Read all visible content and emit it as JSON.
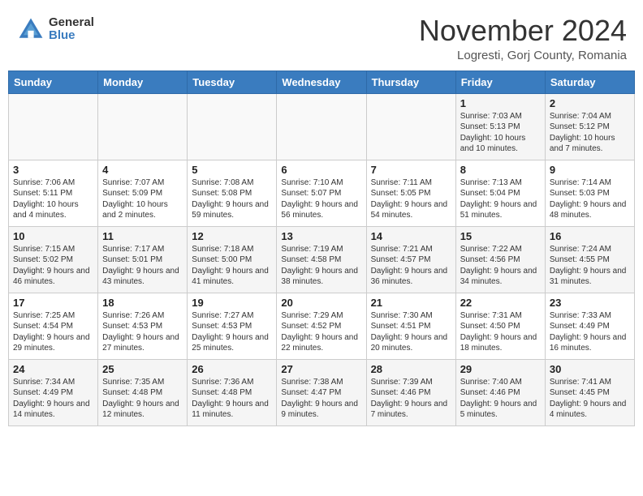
{
  "header": {
    "logo_general": "General",
    "logo_blue": "Blue",
    "month_title": "November 2024",
    "location": "Logresti, Gorj County, Romania"
  },
  "days_of_week": [
    "Sunday",
    "Monday",
    "Tuesday",
    "Wednesday",
    "Thursday",
    "Friday",
    "Saturday"
  ],
  "weeks": [
    [
      {
        "day": "",
        "info": ""
      },
      {
        "day": "",
        "info": ""
      },
      {
        "day": "",
        "info": ""
      },
      {
        "day": "",
        "info": ""
      },
      {
        "day": "",
        "info": ""
      },
      {
        "day": "1",
        "info": "Sunrise: 7:03 AM\nSunset: 5:13 PM\nDaylight: 10 hours and 10 minutes."
      },
      {
        "day": "2",
        "info": "Sunrise: 7:04 AM\nSunset: 5:12 PM\nDaylight: 10 hours and 7 minutes."
      }
    ],
    [
      {
        "day": "3",
        "info": "Sunrise: 7:06 AM\nSunset: 5:11 PM\nDaylight: 10 hours and 4 minutes."
      },
      {
        "day": "4",
        "info": "Sunrise: 7:07 AM\nSunset: 5:09 PM\nDaylight: 10 hours and 2 minutes."
      },
      {
        "day": "5",
        "info": "Sunrise: 7:08 AM\nSunset: 5:08 PM\nDaylight: 9 hours and 59 minutes."
      },
      {
        "day": "6",
        "info": "Sunrise: 7:10 AM\nSunset: 5:07 PM\nDaylight: 9 hours and 56 minutes."
      },
      {
        "day": "7",
        "info": "Sunrise: 7:11 AM\nSunset: 5:05 PM\nDaylight: 9 hours and 54 minutes."
      },
      {
        "day": "8",
        "info": "Sunrise: 7:13 AM\nSunset: 5:04 PM\nDaylight: 9 hours and 51 minutes."
      },
      {
        "day": "9",
        "info": "Sunrise: 7:14 AM\nSunset: 5:03 PM\nDaylight: 9 hours and 48 minutes."
      }
    ],
    [
      {
        "day": "10",
        "info": "Sunrise: 7:15 AM\nSunset: 5:02 PM\nDaylight: 9 hours and 46 minutes."
      },
      {
        "day": "11",
        "info": "Sunrise: 7:17 AM\nSunset: 5:01 PM\nDaylight: 9 hours and 43 minutes."
      },
      {
        "day": "12",
        "info": "Sunrise: 7:18 AM\nSunset: 5:00 PM\nDaylight: 9 hours and 41 minutes."
      },
      {
        "day": "13",
        "info": "Sunrise: 7:19 AM\nSunset: 4:58 PM\nDaylight: 9 hours and 38 minutes."
      },
      {
        "day": "14",
        "info": "Sunrise: 7:21 AM\nSunset: 4:57 PM\nDaylight: 9 hours and 36 minutes."
      },
      {
        "day": "15",
        "info": "Sunrise: 7:22 AM\nSunset: 4:56 PM\nDaylight: 9 hours and 34 minutes."
      },
      {
        "day": "16",
        "info": "Sunrise: 7:24 AM\nSunset: 4:55 PM\nDaylight: 9 hours and 31 minutes."
      }
    ],
    [
      {
        "day": "17",
        "info": "Sunrise: 7:25 AM\nSunset: 4:54 PM\nDaylight: 9 hours and 29 minutes."
      },
      {
        "day": "18",
        "info": "Sunrise: 7:26 AM\nSunset: 4:53 PM\nDaylight: 9 hours and 27 minutes."
      },
      {
        "day": "19",
        "info": "Sunrise: 7:27 AM\nSunset: 4:53 PM\nDaylight: 9 hours and 25 minutes."
      },
      {
        "day": "20",
        "info": "Sunrise: 7:29 AM\nSunset: 4:52 PM\nDaylight: 9 hours and 22 minutes."
      },
      {
        "day": "21",
        "info": "Sunrise: 7:30 AM\nSunset: 4:51 PM\nDaylight: 9 hours and 20 minutes."
      },
      {
        "day": "22",
        "info": "Sunrise: 7:31 AM\nSunset: 4:50 PM\nDaylight: 9 hours and 18 minutes."
      },
      {
        "day": "23",
        "info": "Sunrise: 7:33 AM\nSunset: 4:49 PM\nDaylight: 9 hours and 16 minutes."
      }
    ],
    [
      {
        "day": "24",
        "info": "Sunrise: 7:34 AM\nSunset: 4:49 PM\nDaylight: 9 hours and 14 minutes."
      },
      {
        "day": "25",
        "info": "Sunrise: 7:35 AM\nSunset: 4:48 PM\nDaylight: 9 hours and 12 minutes."
      },
      {
        "day": "26",
        "info": "Sunrise: 7:36 AM\nSunset: 4:48 PM\nDaylight: 9 hours and 11 minutes."
      },
      {
        "day": "27",
        "info": "Sunrise: 7:38 AM\nSunset: 4:47 PM\nDaylight: 9 hours and 9 minutes."
      },
      {
        "day": "28",
        "info": "Sunrise: 7:39 AM\nSunset: 4:46 PM\nDaylight: 9 hours and 7 minutes."
      },
      {
        "day": "29",
        "info": "Sunrise: 7:40 AM\nSunset: 4:46 PM\nDaylight: 9 hours and 5 minutes."
      },
      {
        "day": "30",
        "info": "Sunrise: 7:41 AM\nSunset: 4:45 PM\nDaylight: 9 hours and 4 minutes."
      }
    ]
  ]
}
